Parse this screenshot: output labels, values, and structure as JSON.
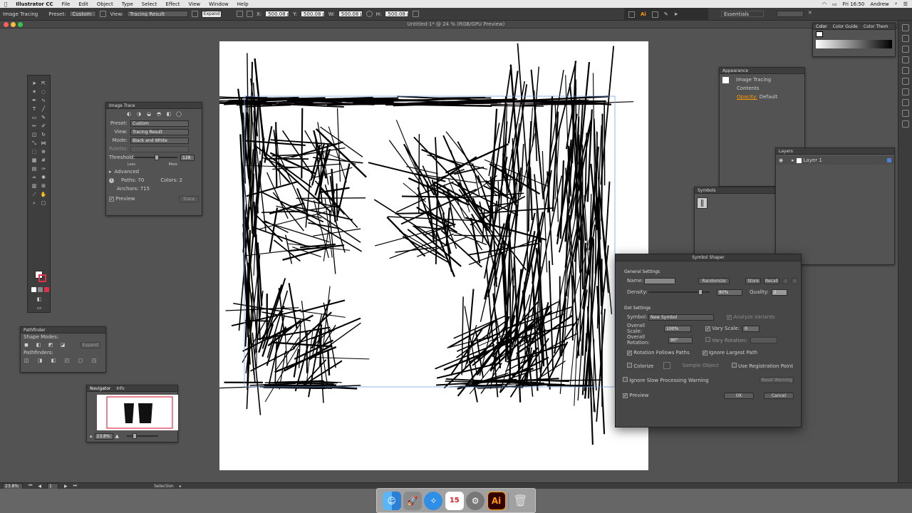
{
  "menubar": {
    "app_name": "Illustrator CC",
    "items": [
      "File",
      "Edit",
      "Object",
      "Type",
      "Select",
      "Effect",
      "View",
      "Window",
      "Help"
    ],
    "clock": "Fri 16:50",
    "user": "Andrew"
  },
  "control_bar": {
    "mode_label": "Image Tracing",
    "preset_label": "Preset:",
    "preset_value": "Custom",
    "view_label": "View:",
    "view_value": "Tracing Result",
    "expand_button": "Expand",
    "x_value": "500.08 px",
    "y_value": "500.08 px",
    "w_value": "500.08 px",
    "h_value": "500.08 px",
    "workspace": "Essentials"
  },
  "document": {
    "title": "Untitled-1* @ 24 % (RGB/GPU Preview)"
  },
  "image_trace_panel": {
    "title": "Image Trace",
    "preset_label": "Preset:",
    "preset_value": "Custom",
    "view_label": "View:",
    "view_value": "Tracing Result",
    "mode_label": "Mode:",
    "mode_value": "Black and White",
    "palette_label": "Palette:",
    "threshold_label": "Threshold:",
    "threshold_value": "128",
    "less_label": "Less",
    "more_label": "More",
    "advanced_label": "Advanced",
    "paths_label": "Paths:",
    "paths_value": "70",
    "colors_label": "Colors:",
    "colors_value": "2",
    "anchors_label": "Anchors:",
    "anchors_value": "715",
    "preview_label": "Preview",
    "trace_button": "Trace"
  },
  "pathfinder_panel": {
    "title": "Pathfinder",
    "shape_modes_label": "Shape Modes:",
    "expand_button": "Expand",
    "pathfinders_label": "Pathfinders:"
  },
  "navigator_panel": {
    "tab_navigator": "Navigator",
    "tab_info": "Info",
    "zoom_value": "23.8%"
  },
  "appearance_panel": {
    "title": "Appearance",
    "item_name": "Image Tracing",
    "contents_label": "Contents",
    "opacity_label": "Opacity:",
    "opacity_value": "Default"
  },
  "symbols_panel": {
    "title": "Symbols"
  },
  "layers_panel": {
    "title": "Layers",
    "layer_name": "Layer 1"
  },
  "color_panel": {
    "tab_color": "Color",
    "tab_color_guide": "Color Guide",
    "tab_swatches": "Color Them"
  },
  "symbol_sprayer_dialog": {
    "title": "Symbol Shaper",
    "general_settings": "General Settings",
    "name_label": "Name:",
    "name_value": "",
    "randomize_button": "Randomize",
    "store_button": "Store",
    "recall_button": "Recall",
    "density_label": "Density:",
    "density_value": "80%",
    "quality_label": "Quality:",
    "quality_value": "2",
    "dot_settings": "Dot Settings",
    "symbol_label": "Symbol:",
    "symbol_value": "New Symbol",
    "analyze_variants_label": "Analyze Variants",
    "overall_scale_label": "Overall Scale:",
    "overall_scale_value": "100%",
    "vary_scale_label": "Vary Scale:",
    "vary_scale_value": "0",
    "overall_rotation_label": "Overall Rotation:",
    "overall_rotation_value": "90°",
    "vary_rotation_label": "Vary Rotation:",
    "rotation_follows_paths_label": "Rotation Follows Paths",
    "ignore_largest_path_label": "Ignore Largest Path",
    "colorize_label": "Colorize",
    "sample_object_label": "Sample Object",
    "use_registration_point_label": "Use Registration Point",
    "ignore_slow_warning_label": "Ignore Slow Processing Warning",
    "reset_warning_button": "Reset Warning",
    "preview_label": "Preview",
    "ok_button": "OK",
    "cancel_button": "Cancel"
  },
  "status_bar": {
    "zoom_value": "23.8%",
    "page_value": "1",
    "tool_value": "Selection"
  },
  "dock": {
    "ai_label": "Ai",
    "calendar_day": "15"
  },
  "colors": {
    "accent_orange": "#ff9a00",
    "selection_blue": "#4c7fd6",
    "menu_bg": "#e7e7e7",
    "panel_bg": "#535353"
  }
}
